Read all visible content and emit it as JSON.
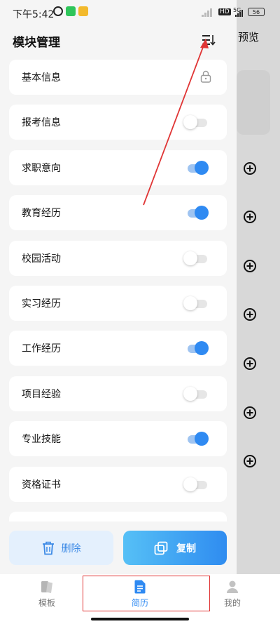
{
  "status_bar": {
    "time": "下午5:42",
    "network_type": "5G",
    "hd_label": "HD",
    "battery": "56"
  },
  "background": {
    "preview_label": "预览"
  },
  "drawer": {
    "title": "模块管理",
    "modules": [
      {
        "label": "基本信息",
        "control": "lock"
      },
      {
        "label": "报考信息",
        "control": "toggle",
        "enabled": false
      },
      {
        "label": "求职意向",
        "control": "toggle",
        "enabled": true
      },
      {
        "label": "教育经历",
        "control": "toggle",
        "enabled": true
      },
      {
        "label": "校园活动",
        "control": "toggle",
        "enabled": false
      },
      {
        "label": "实习经历",
        "control": "toggle",
        "enabled": false
      },
      {
        "label": "工作经历",
        "control": "toggle",
        "enabled": true
      },
      {
        "label": "项目经验",
        "control": "toggle",
        "enabled": false
      },
      {
        "label": "专业技能",
        "control": "toggle",
        "enabled": true
      },
      {
        "label": "资格证书",
        "control": "toggle",
        "enabled": false
      }
    ],
    "delete_label": "删除",
    "copy_label": "复制"
  },
  "bottom_nav": {
    "items": [
      {
        "label": "模板",
        "icon": "template-icon",
        "active": false
      },
      {
        "label": "简历",
        "icon": "resume-icon",
        "active": true
      },
      {
        "label": "我的",
        "icon": "profile-icon",
        "active": false
      }
    ]
  },
  "colors": {
    "accent": "#2f8af2",
    "annotation": "#e03535",
    "toggle_on": "#2f8af2"
  }
}
